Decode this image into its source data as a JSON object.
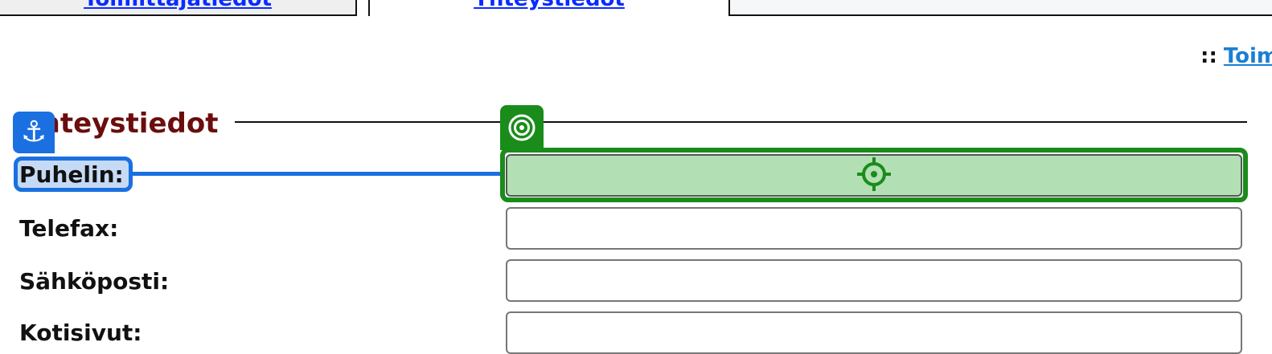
{
  "tabs": [
    {
      "label": "Toimittajatiedot"
    },
    {
      "label": "Yhteystiedot"
    },
    {
      "label": ""
    }
  ],
  "top_link": {
    "separator": "::",
    "label": "Toim"
  },
  "section": {
    "title": "Yhteystiedot"
  },
  "fields": [
    {
      "label": "Puhelin:",
      "value": ""
    },
    {
      "label": "Telefax:",
      "value": ""
    },
    {
      "label": "Sähköposti:",
      "value": ""
    },
    {
      "label": "Kotisivut:",
      "value": ""
    }
  ],
  "colors": {
    "label_highlight": "#1a70e0",
    "field_highlight": "#1a8c1a",
    "link": "#0a2cff",
    "section_title": "#6b0d0d"
  },
  "icons": {
    "label_marker": "anchor-icon",
    "field_marker": "target-icon",
    "field_center": "crosshair-icon"
  }
}
